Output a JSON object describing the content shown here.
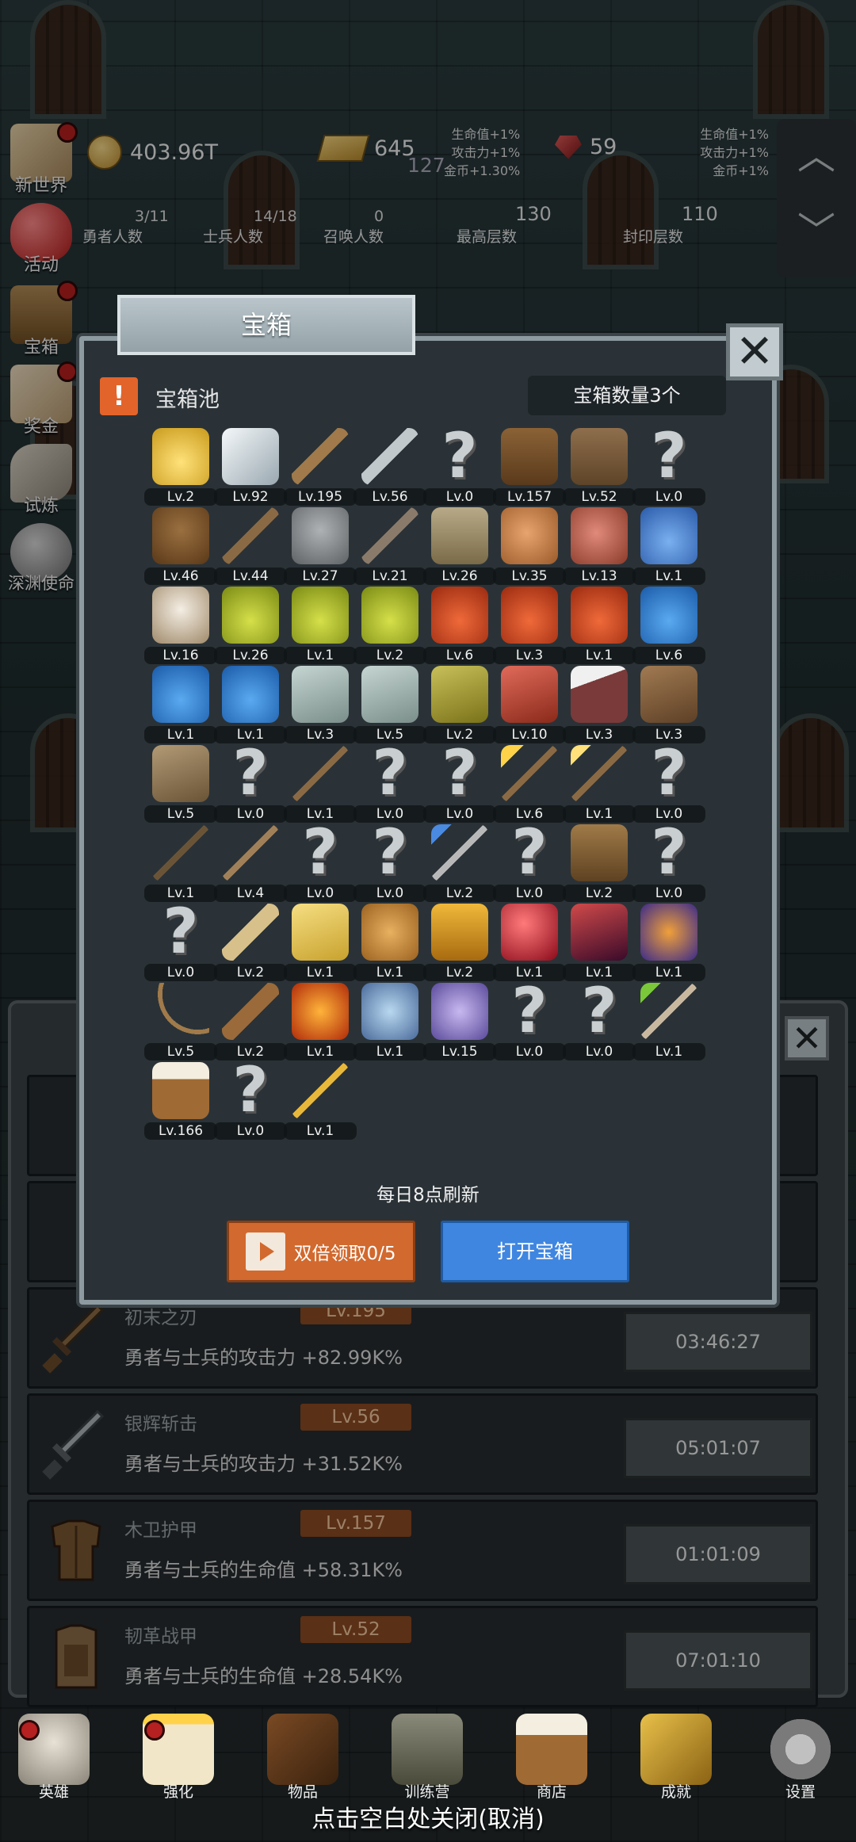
{
  "hud": {
    "coins": "403.96T",
    "gold": "645",
    "gold_sub": "127",
    "gems": "59",
    "bonus_left": [
      "生命值+1%",
      "攻击力+1%",
      "金币+1.30%"
    ],
    "bonus_right": [
      "生命值+1%",
      "攻击力+1%",
      "金币+1%"
    ],
    "hero_count": "3/11",
    "hero_label": "勇者人数",
    "soldier_count": "14/18",
    "soldier_label": "士兵人数",
    "summon_count": "0",
    "summon_label": "召唤人数",
    "max_floor": "130",
    "max_floor_label": "最高层数",
    "seal_floor": "110",
    "seal_floor_label": "封印层数"
  },
  "sidebar": {
    "items": [
      {
        "label": "新世界",
        "icon": "map-icon"
      },
      {
        "label": "活动",
        "icon": "heart-icon"
      },
      {
        "label": "宝箱",
        "icon": "chest-icon"
      },
      {
        "label": "奖金",
        "icon": "envelope-icon"
      },
      {
        "label": "试炼",
        "icon": "feather-icon"
      },
      {
        "label": "深渊使命",
        "icon": "orb-icon"
      }
    ]
  },
  "modal": {
    "title": "宝箱",
    "pool_label": "宝箱池",
    "chest_count": "宝箱数量3个",
    "refresh_text": "每日8点刷新",
    "double_button": "双倍领取0/5",
    "open_button": "打开宝箱",
    "items": [
      {
        "lv": "Lv.2",
        "icon": "crown"
      },
      {
        "lv": "Lv.92",
        "icon": "diamond"
      },
      {
        "lv": "Lv.195",
        "icon": "sword"
      },
      {
        "lv": "Lv.56",
        "icon": "sword-steel"
      },
      {
        "lv": "Lv.0",
        "icon": "unknown"
      },
      {
        "lv": "Lv.157",
        "icon": "armor"
      },
      {
        "lv": "Lv.52",
        "icon": "leather-armor"
      },
      {
        "lv": "Lv.0",
        "icon": "unknown"
      },
      {
        "lv": "Lv.46",
        "icon": "helmet"
      },
      {
        "lv": "Lv.44",
        "icon": "dagger"
      },
      {
        "lv": "Lv.27",
        "icon": "knight-helmet"
      },
      {
        "lv": "Lv.21",
        "icon": "hammer"
      },
      {
        "lv": "Lv.26",
        "icon": "great-helm"
      },
      {
        "lv": "Lv.35",
        "icon": "ham"
      },
      {
        "lv": "Lv.13",
        "icon": "steak"
      },
      {
        "lv": "Lv.1",
        "icon": "pouch"
      },
      {
        "lv": "Lv.16",
        "icon": "rice-bowl"
      },
      {
        "lv": "Lv.26",
        "icon": "potion-yellow"
      },
      {
        "lv": "Lv.1",
        "icon": "potion-yellow"
      },
      {
        "lv": "Lv.2",
        "icon": "potion-yellow"
      },
      {
        "lv": "Lv.6",
        "icon": "potion-red"
      },
      {
        "lv": "Lv.3",
        "icon": "potion-red"
      },
      {
        "lv": "Lv.1",
        "icon": "potion-red"
      },
      {
        "lv": "Lv.6",
        "icon": "potion-blue"
      },
      {
        "lv": "Lv.1",
        "icon": "potion-blue"
      },
      {
        "lv": "Lv.1",
        "icon": "potion-blue"
      },
      {
        "lv": "Lv.3",
        "icon": "flask"
      },
      {
        "lv": "Lv.5",
        "icon": "flask"
      },
      {
        "lv": "Lv.2",
        "icon": "bottle"
      },
      {
        "lv": "Lv.10",
        "icon": "bottle-red"
      },
      {
        "lv": "Lv.3",
        "icon": "winged-boot"
      },
      {
        "lv": "Lv.3",
        "icon": "boot"
      },
      {
        "lv": "Lv.5",
        "icon": "shoe"
      },
      {
        "lv": "Lv.0",
        "icon": "unknown"
      },
      {
        "lv": "Lv.1",
        "icon": "staff"
      },
      {
        "lv": "Lv.0",
        "icon": "unknown"
      },
      {
        "lv": "Lv.0",
        "icon": "unknown"
      },
      {
        "lv": "Lv.6",
        "icon": "torch"
      },
      {
        "lv": "Lv.1",
        "icon": "wand"
      },
      {
        "lv": "Lv.0",
        "icon": "unknown"
      },
      {
        "lv": "Lv.1",
        "icon": "pickaxe"
      },
      {
        "lv": "Lv.4",
        "icon": "crook"
      },
      {
        "lv": "Lv.0",
        "icon": "unknown"
      },
      {
        "lv": "Lv.0",
        "icon": "unknown"
      },
      {
        "lv": "Lv.2",
        "icon": "scepter"
      },
      {
        "lv": "Lv.0",
        "icon": "unknown"
      },
      {
        "lv": "Lv.2",
        "icon": "backpack"
      },
      {
        "lv": "Lv.0",
        "icon": "unknown"
      },
      {
        "lv": "Lv.0",
        "icon": "unknown"
      },
      {
        "lv": "Lv.2",
        "icon": "club"
      },
      {
        "lv": "Lv.1",
        "icon": "cheese"
      },
      {
        "lv": "Lv.1",
        "icon": "pie"
      },
      {
        "lv": "Lv.2",
        "icon": "honey-jar"
      },
      {
        "lv": "Lv.1",
        "icon": "red-orb"
      },
      {
        "lv": "Lv.1",
        "icon": "crystal"
      },
      {
        "lv": "Lv.1",
        "icon": "rune-gem"
      },
      {
        "lv": "Lv.5",
        "icon": "bow"
      },
      {
        "lv": "Lv.2",
        "icon": "crossbow"
      },
      {
        "lv": "Lv.1",
        "icon": "fire-gauntlet"
      },
      {
        "lv": "Lv.1",
        "icon": "ice-cloak"
      },
      {
        "lv": "Lv.15",
        "icon": "spirit"
      },
      {
        "lv": "Lv.0",
        "icon": "unknown"
      },
      {
        "lv": "Lv.0",
        "icon": "unknown"
      },
      {
        "lv": "Lv.1",
        "icon": "green-wand"
      },
      {
        "lv": "Lv.166",
        "icon": "beer-mug"
      },
      {
        "lv": "Lv.0",
        "icon": "unknown"
      },
      {
        "lv": "Lv.1",
        "icon": "gold-pickaxe"
      }
    ]
  },
  "list": {
    "rows": [
      {
        "name": "初末之刃",
        "lv": "Lv.195",
        "desc": "勇者与士兵的攻击力 +82.99K%",
        "timer": "03:46:27",
        "icon": "sword"
      },
      {
        "name": "银辉斩击",
        "lv": "Lv.56",
        "desc": "勇者与士兵的攻击力 +31.52K%",
        "timer": "05:01:07",
        "icon": "sword-steel"
      },
      {
        "name": "木卫护甲",
        "lv": "Lv.157",
        "desc": "勇者与士兵的生命值 +58.31K%",
        "timer": "01:01:09",
        "icon": "armor"
      },
      {
        "name": "韧革战甲",
        "lv": "Lv.52",
        "desc": "勇者与士兵的生命值 +28.54K%",
        "timer": "07:01:10",
        "icon": "leather-armor"
      }
    ]
  },
  "nav": {
    "items": [
      {
        "label": "英雄",
        "icon": "skull-icon"
      },
      {
        "label": "强化",
        "icon": "candle-icon"
      },
      {
        "label": "物品",
        "icon": "book-icon"
      },
      {
        "label": "训练营",
        "icon": "lantern-icon"
      },
      {
        "label": "商店",
        "icon": "mug-icon"
      },
      {
        "label": "成就",
        "icon": "key-icon"
      },
      {
        "label": "设置",
        "icon": "gear-icon"
      }
    ],
    "close_hint": "点击空白处关闭(取消)"
  }
}
